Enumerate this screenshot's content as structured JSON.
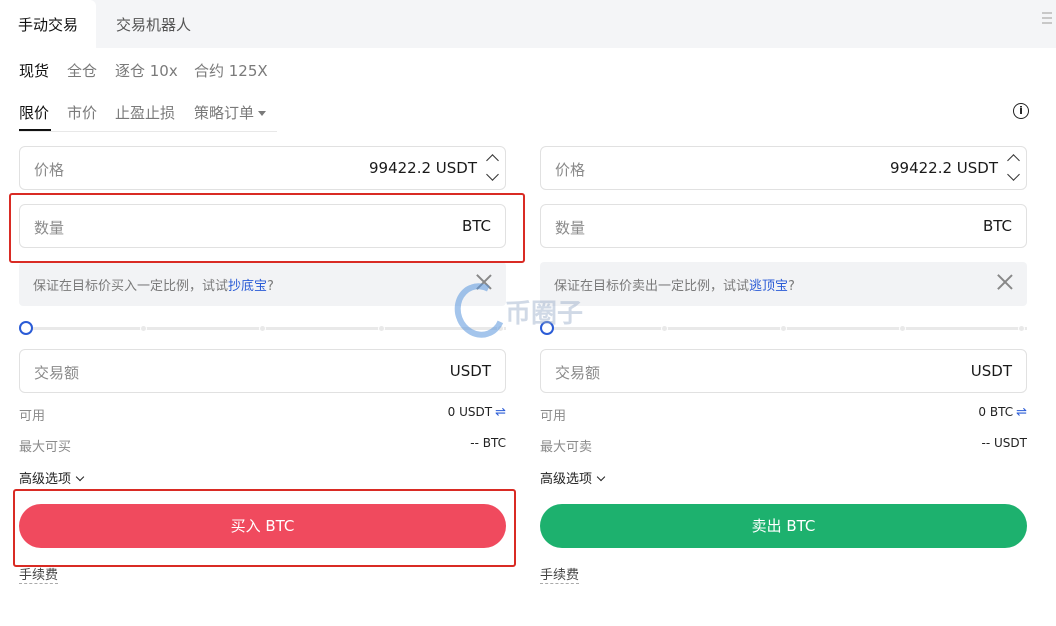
{
  "top_tabs": {
    "manual": "手动交易",
    "bot": "交易机器人"
  },
  "modes": [
    "现货",
    "全仓",
    "逐仓 10x",
    "合约 125X"
  ],
  "order_types": [
    "限价",
    "市价",
    "止盈止损",
    "策略订单"
  ],
  "info_icon": "i",
  "buy": {
    "price_label": "价格",
    "price_value": "99422.2 USDT",
    "qty_label": "数量",
    "qty_unit": "BTC",
    "promo_text": "保证在目标价买入一定比例，试试",
    "promo_link": "抄底宝",
    "promo_tail": "?",
    "amount_label": "交易额",
    "amount_unit": "USDT",
    "available_label": "可用",
    "available_value": "0 USDT",
    "max_label": "最大可买",
    "max_value": "-- BTC",
    "advanced": "高级选项",
    "action": "买入 BTC",
    "fee": "手续费",
    "slider_value": 0
  },
  "sell": {
    "price_label": "价格",
    "price_value": "99422.2 USDT",
    "qty_label": "数量",
    "qty_unit": "BTC",
    "promo_text": "保证在目标价卖出一定比例，试试",
    "promo_link": "逃顶宝",
    "promo_tail": "?",
    "amount_label": "交易额",
    "amount_unit": "USDT",
    "available_label": "可用",
    "available_value": "0 BTC",
    "max_label": "最大可卖",
    "max_value": "-- USDT",
    "advanced": "高级选项",
    "action": "卖出 BTC",
    "fee": "手续费",
    "slider_value": 0
  },
  "icons": {
    "swap": "⇌",
    "menu": "menu-icon"
  },
  "colors": {
    "buy": "#f04a5e",
    "sell": "#1db16e",
    "accent": "#2a5bd6",
    "highlight": "#d92b24"
  },
  "watermark": "币圈子"
}
